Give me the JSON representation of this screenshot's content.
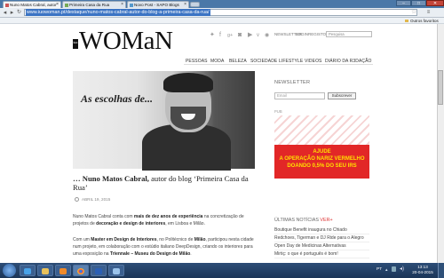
{
  "browser": {
    "tabs": [
      {
        "label": "Nuno Matos Cabral, autor",
        "active": true
      },
      {
        "label": "Primeira Casa da Rua",
        "active": false
      },
      {
        "label": "Novo Post - SAPO Blogs",
        "active": false
      }
    ],
    "url": "www.iuowoman.pt/destaque/nuno-matos-cabral-autor-do-blog-a-primeira-casa-da-rua/",
    "other_bookmarks": "Outros favoritos",
    "window_controls": {
      "minimize": "–",
      "maximize": "□",
      "close": "✕"
    }
  },
  "site": {
    "logo_badge": "iuo",
    "logo": "WOMaN",
    "top_links": [
      "NEWSLETTER",
      "LOGIN",
      "REGISTO"
    ],
    "search_placeholder": "Pesquisa",
    "nav": [
      "PESSOAS",
      "MODA",
      "BELEZA",
      "SOCIEDADE",
      "LIFESTYLE",
      "VIDEOS",
      "DIÁRIO DA R3DAÇÃO"
    ],
    "social_icons": [
      "twitter-icon",
      "facebook-icon",
      "google-plus-icon",
      "camera-icon",
      "youtube-icon",
      "vimeo-icon",
      "rss-icon"
    ]
  },
  "article": {
    "hero_caption": "As escolhas de...",
    "title_prefix": "… Nuno Matos Cabral,",
    "title_rest": " autor do blog ‘Primeira Casa da Rua’",
    "date": "ABRIL 19, 2015",
    "p1_a": "Nuno Matos Cabral conta com ",
    "p1_b": "mais de dez anos de experiência",
    "p1_c": " na concretização de projetos de ",
    "p1_d": "decoração e design de interiores",
    "p1_e": ", em Lisboa e Milão.",
    "p2_a": "Com um ",
    "p2_b": "Master em Design de Interiores",
    "p2_c": ", no Politécnico de ",
    "p2_d": "Milão",
    "p2_e": ", participou nesta cidade num projeto, em colaboração com o estúdio italiano DeepDesign, criando os interiores para uma exposição na ",
    "p2_f": "Triennale – Museu do Design de Milão",
    "p2_g": "."
  },
  "sidebar": {
    "newsletter_title": "NEWSLETTER",
    "email_placeholder": "Email",
    "subscribe_label": "Subscrever",
    "pub_label": "PUB",
    "ad_text": [
      "AJUDE",
      "A OPERAÇÃO NARIZ VERMELHO",
      "DOANDO 0,5% DO SEU IRS"
    ],
    "latest_title": "ÚLTIMAS NOTÍCIAS",
    "latest_suffix": "VER+",
    "latest": [
      "Boutique Benefit inaugura no Chiado",
      "Redchoes, Tigerman e DJ Ride para o Alegro",
      "Open Day de Medicinas Alternativas",
      "Mirtiç: o que é português é bom!"
    ]
  },
  "taskbar": {
    "lang": "PT",
    "time": "13:13",
    "date": "20-04-2015",
    "apps": [
      "ie-icon",
      "folder-icon",
      "media-icon",
      "chrome-icon",
      "word-icon",
      "explorer-icon"
    ]
  },
  "colors": {
    "accent": "#e22727",
    "ad_yellow": "#ffe000",
    "chrome_blue": "#4a78a8"
  }
}
